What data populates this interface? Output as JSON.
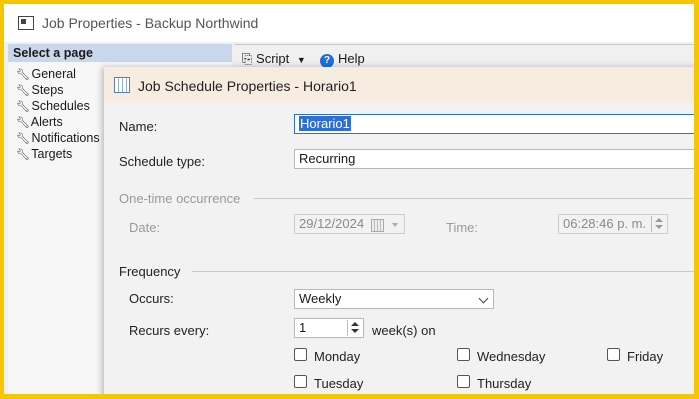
{
  "outer_window": {
    "title": "Job Properties - Backup Northwind",
    "select_page_header": "Select a page",
    "pages": [
      "General",
      "Steps",
      "Schedules",
      "Alerts",
      "Notifications",
      "Targets"
    ],
    "toolbar": {
      "script_label": "Script",
      "help_label": "Help"
    }
  },
  "dialog": {
    "title": "Job Schedule Properties - Horario1",
    "name_label": "Name:",
    "name_value": "Horario1",
    "schedule_type_label": "Schedule type:",
    "schedule_type_value": "Recurring",
    "one_time": {
      "group_label": "One-time occurrence",
      "date_label": "Date:",
      "date_value": "29/12/2024",
      "time_label": "Time:",
      "time_value": "06:28:46 p. m."
    },
    "frequency": {
      "group_label": "Frequency",
      "occurs_label": "Occurs:",
      "occurs_value": "Weekly",
      "recurs_label": "Recurs every:",
      "recurs_value": "1",
      "recurs_unit": "week(s) on",
      "days": {
        "monday": "Monday",
        "tuesday": "Tuesday",
        "wednesday": "Wednesday",
        "thursday": "Thursday",
        "friday": "Friday"
      }
    }
  },
  "colors": {
    "border_highlight": "#f6c700",
    "select_header_bg": "#c9d7ea",
    "dialog_title_bg": "#f6ecdf",
    "selection": "#2f6fd1"
  }
}
